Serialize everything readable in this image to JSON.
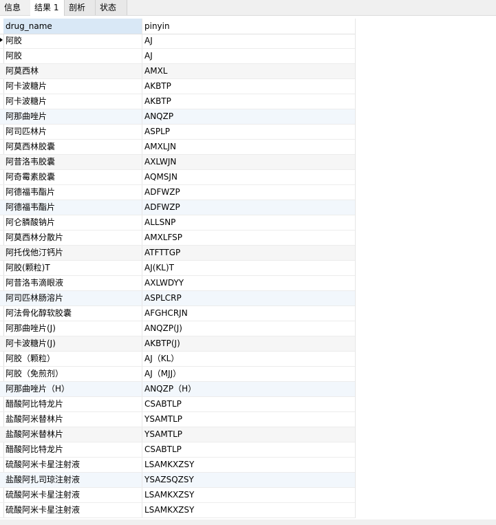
{
  "tabs": [
    {
      "label": "信息"
    },
    {
      "label": "结果 1"
    },
    {
      "label": "剖析"
    },
    {
      "label": "状态"
    }
  ],
  "columns": [
    "drug_name",
    "pinyin"
  ],
  "rows": [
    [
      "阿胶",
      "AJ"
    ],
    [
      "阿胶",
      "AJ"
    ],
    [
      "阿莫西林",
      "AMXL"
    ],
    [
      "阿卡波糖片",
      "AKBTP"
    ],
    [
      "阿卡波糖片",
      "AKBTP"
    ],
    [
      "阿那曲唑片",
      "ANQZP"
    ],
    [
      "阿司匹林片",
      "ASPLP"
    ],
    [
      "阿莫西林胶囊",
      "AMXLJN"
    ],
    [
      "阿昔洛韦胶囊",
      "AXLWJN"
    ],
    [
      "阿奇霉素胶囊",
      "AQMSJN"
    ],
    [
      "阿德福韦酯片",
      "ADFWZP"
    ],
    [
      "阿德福韦酯片",
      "ADFWZP"
    ],
    [
      "阿仑膦酸钠片",
      "ALLSNP"
    ],
    [
      "阿莫西林分散片",
      "AMXLFSP"
    ],
    [
      "阿托伐他汀钙片",
      "ATFTTGP"
    ],
    [
      "阿胶(颗粒)T",
      "AJ(KL)T"
    ],
    [
      "阿昔洛韦滴眼液",
      "AXLWDYY"
    ],
    [
      "阿司匹林肠溶片",
      "ASPLCRP"
    ],
    [
      "阿法骨化醇软胶囊",
      "AFGHCRJN"
    ],
    [
      "阿那曲唑片(J)",
      "ANQZP(J)"
    ],
    [
      "阿卡波糖片(J)",
      "AKBTP(J)"
    ],
    [
      "阿胶（颗粒）",
      "AJ（KL）"
    ],
    [
      "阿胶（免煎剂）",
      "AJ（MJJ）"
    ],
    [
      "阿那曲唑片（H）",
      "ANQZP（H）"
    ],
    [
      "醋酸阿比特龙片",
      "CSABTLP"
    ],
    [
      "盐酸阿米替林片",
      "YSAMTLP"
    ],
    [
      "盐酸阿米替林片",
      "YSAMTLP"
    ],
    [
      "醋酸阿比特龙片",
      "CSABTLP"
    ],
    [
      "硫酸阿米卡星注射液",
      "LSAMKXZSY"
    ],
    [
      "盐酸阿扎司琼注射液",
      "YSAZSQZSY"
    ],
    [
      "硫酸阿米卡星注射液",
      "LSAMKXZSY"
    ],
    [
      "硫酸阿米卡星注射液",
      "LSAMKXZSY"
    ]
  ]
}
